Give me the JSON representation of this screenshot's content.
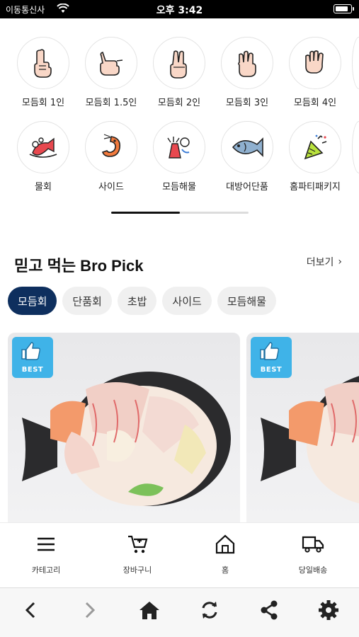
{
  "status_bar": {
    "carrier": "이동통신사",
    "time": "오후 3:42"
  },
  "categories": [
    {
      "label": "모듬회 1인",
      "icon": "hand-one-finger-icon"
    },
    {
      "label": "모듬회 1.5인",
      "icon": "hand-one-half-icon"
    },
    {
      "label": "모듬회 2인",
      "icon": "hand-two-fingers-icon"
    },
    {
      "label": "모듬회 3인",
      "icon": "hand-three-fingers-icon"
    },
    {
      "label": "모듬회 4인",
      "icon": "hand-four-fingers-icon"
    },
    {
      "label": "물회",
      "icon": "cold-raw-fish-icon"
    },
    {
      "label": "사이드",
      "icon": "shrimp-icon"
    },
    {
      "label": "모듬해물",
      "icon": "seafood-icon"
    },
    {
      "label": "대방어단품",
      "icon": "yellowtail-fish-icon"
    },
    {
      "label": "홈파티패키지",
      "icon": "party-popper-icon"
    }
  ],
  "carousel_progress": 0.5,
  "section": {
    "title": "믿고 먹는 Bro Pick",
    "more_label": "더보기"
  },
  "chips": [
    {
      "label": "모듬회",
      "active": true
    },
    {
      "label": "단품회",
      "active": false
    },
    {
      "label": "초밥",
      "active": false
    },
    {
      "label": "사이드",
      "active": false
    },
    {
      "label": "모듬해물",
      "active": false
    }
  ],
  "products": [
    {
      "badge": "BEST"
    },
    {
      "badge": "BEST"
    }
  ],
  "app_nav": [
    {
      "label": "카테고리",
      "icon": "menu-icon"
    },
    {
      "label": "장바구니",
      "icon": "cart-icon"
    },
    {
      "label": "홈",
      "icon": "home-icon"
    },
    {
      "label": "당일배송",
      "icon": "delivery-truck-icon"
    }
  ],
  "browser_bar": [
    "back-icon",
    "forward-icon",
    "home-icon",
    "refresh-icon",
    "share-icon",
    "settings-icon"
  ],
  "colors": {
    "accent": "#0e2f5e",
    "badge": "#3fb3e8"
  }
}
